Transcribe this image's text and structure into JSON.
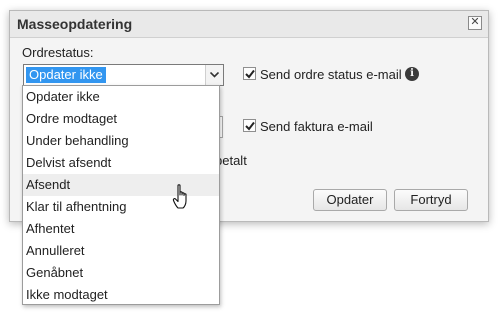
{
  "dialog": {
    "title": "Masseopdatering",
    "close_glyph": "✕",
    "order_status_label": "Ordrestatus:",
    "order_status_value": "Opdater ikke",
    "send_order_status_email_label": "Send ordre status e-mail",
    "send_order_status_email_checked": true,
    "send_invoice_email_label": "Send faktura e-mail",
    "send_invoice_email_checked": true,
    "partial_hidden_text": "betalt",
    "update_button": "Opdater",
    "cancel_button": "Fortryd"
  },
  "dropdown": {
    "hovered_index": 4,
    "options": [
      "Opdater ikke",
      "Ordre modtaget",
      "Under behandling",
      "Delvist afsendt",
      "Afsendt",
      "Klar til afhentning",
      "Afhentet",
      "Annulleret",
      "Genåbnet",
      "Ikke modtaget"
    ]
  },
  "icons": {
    "info": "info-icon",
    "cursor": "hand-pointer-icon",
    "chevron": "chevron-down-icon"
  }
}
